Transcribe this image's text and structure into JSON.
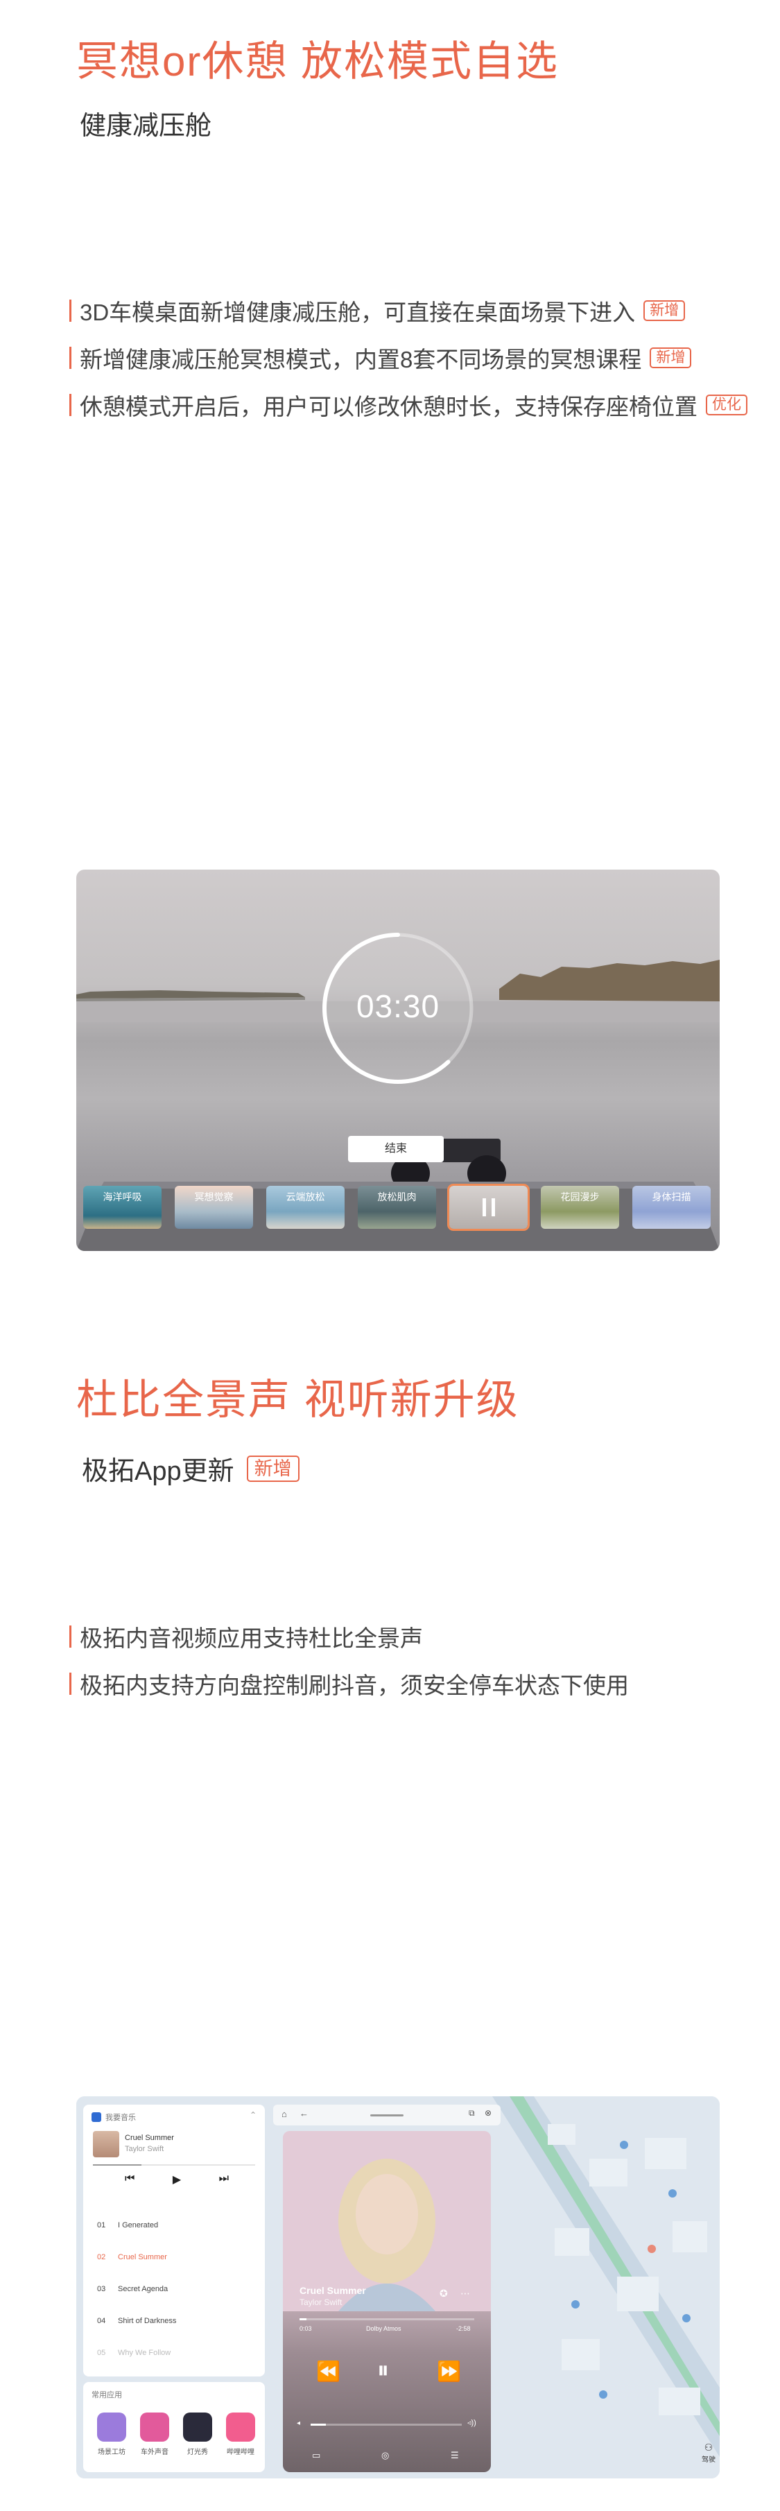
{
  "section1": {
    "title": "冥想or休憩  放松模式自选",
    "subtitle": "健康减压舱",
    "features": [
      {
        "text": "3D车模桌面新增健康减压舱，可直接在桌面场景下进入",
        "tag": "新增"
      },
      {
        "text": "新增健康减压舱冥想模式，内置8套不同场景的冥想课程",
        "tag": "新增"
      },
      {
        "text": "休憩模式开启后，用户可以修改休憩时长，支持保存座椅位置",
        "tag": "优化"
      }
    ]
  },
  "meditation": {
    "timer": "03:30",
    "end_button": "结束",
    "progress": 0.62,
    "scenes": [
      "海洋呼吸",
      "冥想觉察",
      "云端放松",
      "放松肌肉",
      "",
      "花园漫步",
      "身体扫描"
    ],
    "selected_scene_index": 4,
    "pause_icon": "pause-icon"
  },
  "section2": {
    "title": "杜比全景声  视听新升级",
    "subtitle": "极拓App更新",
    "subtitle_tag": "新增",
    "features": [
      {
        "text": "极拓内音视频应用支持杜比全景声"
      },
      {
        "text": "极拓内支持方向盘控制刷抖音，须安全停车状态下使用"
      }
    ]
  },
  "car": {
    "widget_title": "我要音乐",
    "mini_song": "Cruel Summer",
    "mini_artist": "Taylor Swift",
    "tracks": [
      {
        "num": "01",
        "name": "I Generated"
      },
      {
        "num": "02",
        "name": "Cruel Summer"
      },
      {
        "num": "03",
        "name": "Secret Agenda"
      },
      {
        "num": "04",
        "name": "Shirt of Darkness"
      },
      {
        "num": "05",
        "name": "Why We Follow"
      }
    ],
    "active_track_index": 1,
    "apps_title": "常用应用",
    "apps": [
      {
        "label": "场景工坊",
        "color": "#9b7bdc"
      },
      {
        "label": "车外声音",
        "color": "#e25a9b"
      },
      {
        "label": "灯光秀",
        "color": "#2a2a3a"
      },
      {
        "label": "哔哩哔哩",
        "color": "#f25d8e"
      }
    ],
    "player_song": "Cruel Summer",
    "player_artist": "Taylor Swift",
    "time_elapsed": "0:03",
    "time_remaining": "-2:58",
    "dolby_label": "Dolby Atmos",
    "map_button": "驾驶"
  }
}
